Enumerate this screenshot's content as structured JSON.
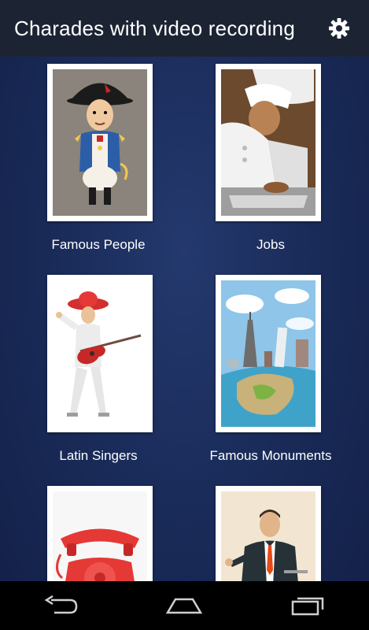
{
  "app_bar": {
    "title": "Charades with video recording",
    "settings_icon": "gear-icon"
  },
  "categories": [
    {
      "label": "Famous People",
      "image": "napoleon-illustration"
    },
    {
      "label": "Jobs",
      "image": "chef-illustration"
    },
    {
      "label": "Latin Singers",
      "image": "guitarist-with-sombrero-illustration"
    },
    {
      "label": "Famous Monuments",
      "image": "world-monuments-illustration"
    },
    {
      "label": "",
      "image": "red-telephone-illustration"
    },
    {
      "label": "",
      "image": "businessman-speaking-illustration"
    }
  ],
  "nav": {
    "back_icon": "back-icon",
    "home_icon": "home-icon",
    "recents_icon": "recent-apps-icon"
  }
}
